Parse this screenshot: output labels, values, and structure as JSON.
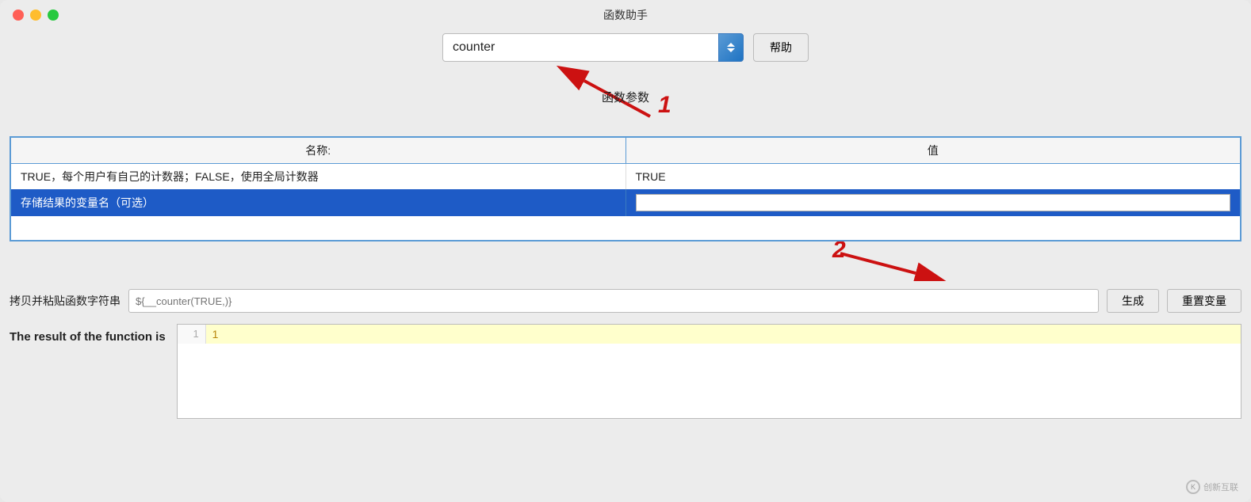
{
  "window": {
    "title": "函数助手"
  },
  "controls": {
    "search_value": "counter",
    "search_placeholder": "counter",
    "help_label": "帮助",
    "spinner_icon": "spinner"
  },
  "func_params": {
    "section_label": "函数参数",
    "annotation_1": "1",
    "annotation_2": "2"
  },
  "table": {
    "col_name_header": "名称:",
    "col_value_header": "值",
    "rows": [
      {
        "name": "TRUE，每个用户有自己的计数器；FALSE，使用全局计数器",
        "value": "TRUE",
        "selected": false
      },
      {
        "name": "存储结果的变量名（可选）",
        "value": "",
        "selected": true
      },
      {
        "name": "",
        "value": "",
        "selected": false
      }
    ]
  },
  "bottom": {
    "copy_paste_label": "拷贝并粘贴函数字符串",
    "copy_paste_placeholder": "${__counter(TRUE,)}",
    "generate_label": "生成",
    "reset_label": "重置变量"
  },
  "result": {
    "label": "The result of the function is",
    "line_number": "1",
    "line_value": "1"
  },
  "watermark": {
    "text": "创新互联",
    "icon": "K"
  }
}
